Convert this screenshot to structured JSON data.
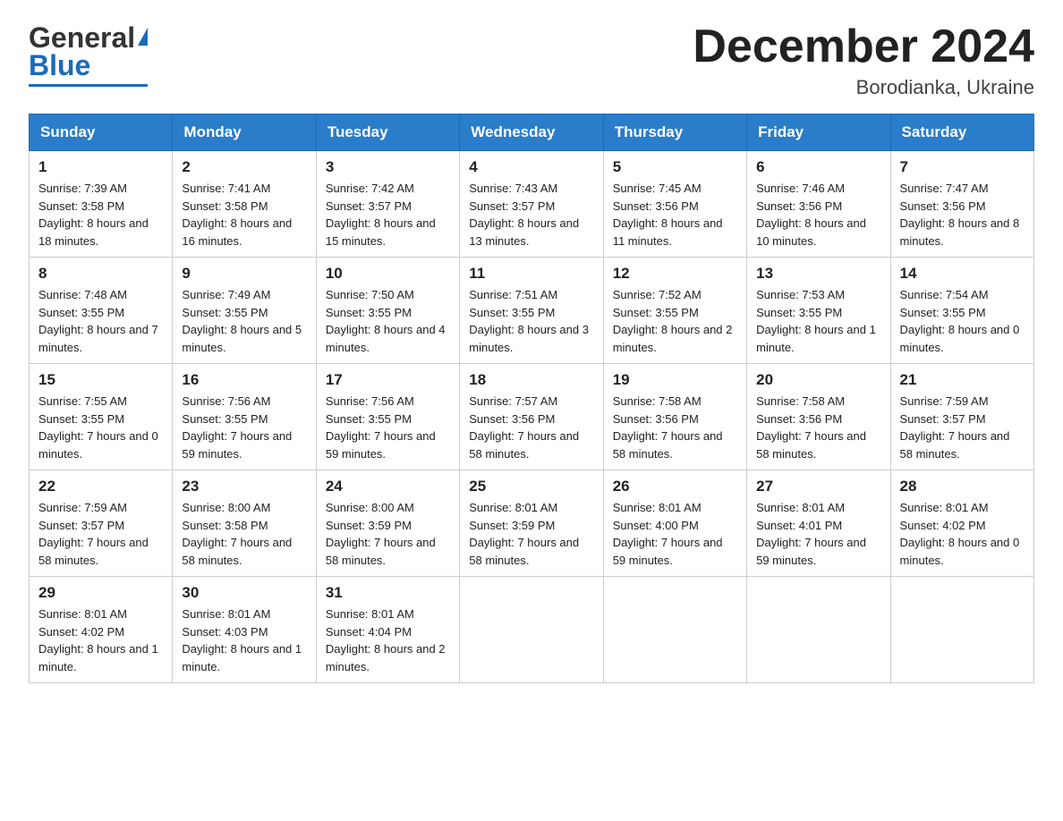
{
  "logo": {
    "text_general": "General",
    "text_blue": "Blue"
  },
  "title": "December 2024",
  "subtitle": "Borodianka, Ukraine",
  "days_of_week": [
    "Sunday",
    "Monday",
    "Tuesday",
    "Wednesday",
    "Thursday",
    "Friday",
    "Saturday"
  ],
  "weeks": [
    [
      {
        "day": "1",
        "sunrise": "7:39 AM",
        "sunset": "3:58 PM",
        "daylight": "8 hours and 18 minutes."
      },
      {
        "day": "2",
        "sunrise": "7:41 AM",
        "sunset": "3:58 PM",
        "daylight": "8 hours and 16 minutes."
      },
      {
        "day": "3",
        "sunrise": "7:42 AM",
        "sunset": "3:57 PM",
        "daylight": "8 hours and 15 minutes."
      },
      {
        "day": "4",
        "sunrise": "7:43 AM",
        "sunset": "3:57 PM",
        "daylight": "8 hours and 13 minutes."
      },
      {
        "day": "5",
        "sunrise": "7:45 AM",
        "sunset": "3:56 PM",
        "daylight": "8 hours and 11 minutes."
      },
      {
        "day": "6",
        "sunrise": "7:46 AM",
        "sunset": "3:56 PM",
        "daylight": "8 hours and 10 minutes."
      },
      {
        "day": "7",
        "sunrise": "7:47 AM",
        "sunset": "3:56 PM",
        "daylight": "8 hours and 8 minutes."
      }
    ],
    [
      {
        "day": "8",
        "sunrise": "7:48 AM",
        "sunset": "3:55 PM",
        "daylight": "8 hours and 7 minutes."
      },
      {
        "day": "9",
        "sunrise": "7:49 AM",
        "sunset": "3:55 PM",
        "daylight": "8 hours and 5 minutes."
      },
      {
        "day": "10",
        "sunrise": "7:50 AM",
        "sunset": "3:55 PM",
        "daylight": "8 hours and 4 minutes."
      },
      {
        "day": "11",
        "sunrise": "7:51 AM",
        "sunset": "3:55 PM",
        "daylight": "8 hours and 3 minutes."
      },
      {
        "day": "12",
        "sunrise": "7:52 AM",
        "sunset": "3:55 PM",
        "daylight": "8 hours and 2 minutes."
      },
      {
        "day": "13",
        "sunrise": "7:53 AM",
        "sunset": "3:55 PM",
        "daylight": "8 hours and 1 minute."
      },
      {
        "day": "14",
        "sunrise": "7:54 AM",
        "sunset": "3:55 PM",
        "daylight": "8 hours and 0 minutes."
      }
    ],
    [
      {
        "day": "15",
        "sunrise": "7:55 AM",
        "sunset": "3:55 PM",
        "daylight": "7 hours and 0 minutes."
      },
      {
        "day": "16",
        "sunrise": "7:56 AM",
        "sunset": "3:55 PM",
        "daylight": "7 hours and 59 minutes."
      },
      {
        "day": "17",
        "sunrise": "7:56 AM",
        "sunset": "3:55 PM",
        "daylight": "7 hours and 59 minutes."
      },
      {
        "day": "18",
        "sunrise": "7:57 AM",
        "sunset": "3:56 PM",
        "daylight": "7 hours and 58 minutes."
      },
      {
        "day": "19",
        "sunrise": "7:58 AM",
        "sunset": "3:56 PM",
        "daylight": "7 hours and 58 minutes."
      },
      {
        "day": "20",
        "sunrise": "7:58 AM",
        "sunset": "3:56 PM",
        "daylight": "7 hours and 58 minutes."
      },
      {
        "day": "21",
        "sunrise": "7:59 AM",
        "sunset": "3:57 PM",
        "daylight": "7 hours and 58 minutes."
      }
    ],
    [
      {
        "day": "22",
        "sunrise": "7:59 AM",
        "sunset": "3:57 PM",
        "daylight": "7 hours and 58 minutes."
      },
      {
        "day": "23",
        "sunrise": "8:00 AM",
        "sunset": "3:58 PM",
        "daylight": "7 hours and 58 minutes."
      },
      {
        "day": "24",
        "sunrise": "8:00 AM",
        "sunset": "3:59 PM",
        "daylight": "7 hours and 58 minutes."
      },
      {
        "day": "25",
        "sunrise": "8:01 AM",
        "sunset": "3:59 PM",
        "daylight": "7 hours and 58 minutes."
      },
      {
        "day": "26",
        "sunrise": "8:01 AM",
        "sunset": "4:00 PM",
        "daylight": "7 hours and 59 minutes."
      },
      {
        "day": "27",
        "sunrise": "8:01 AM",
        "sunset": "4:01 PM",
        "daylight": "7 hours and 59 minutes."
      },
      {
        "day": "28",
        "sunrise": "8:01 AM",
        "sunset": "4:02 PM",
        "daylight": "8 hours and 0 minutes."
      }
    ],
    [
      {
        "day": "29",
        "sunrise": "8:01 AM",
        "sunset": "4:02 PM",
        "daylight": "8 hours and 1 minute."
      },
      {
        "day": "30",
        "sunrise": "8:01 AM",
        "sunset": "4:03 PM",
        "daylight": "8 hours and 1 minute."
      },
      {
        "day": "31",
        "sunrise": "8:01 AM",
        "sunset": "4:04 PM",
        "daylight": "8 hours and 2 minutes."
      },
      null,
      null,
      null,
      null
    ]
  ]
}
